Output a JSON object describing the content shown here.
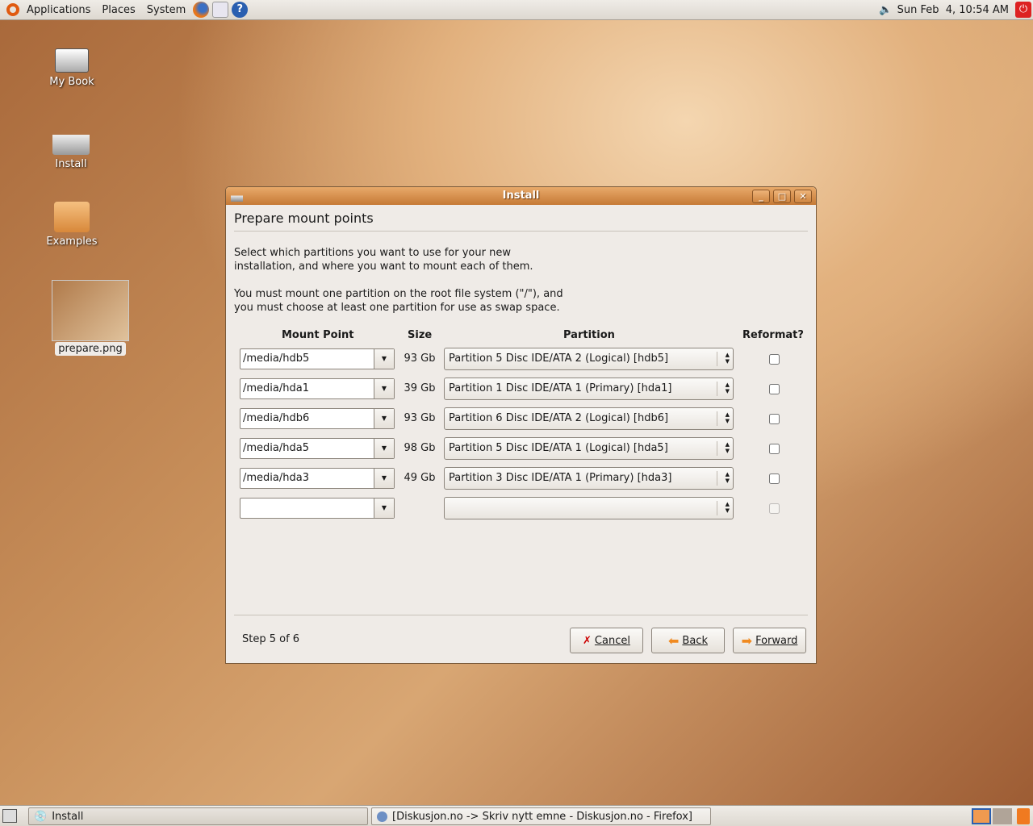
{
  "top_panel": {
    "menus": [
      "Applications",
      "Places",
      "System"
    ],
    "clock": "Sun Feb  4, 10:54 AM"
  },
  "desktop": {
    "icons": [
      "My Book",
      "Install",
      "Examples",
      "prepare.png"
    ]
  },
  "dialog": {
    "title": "Install",
    "heading": "Prepare mount points",
    "intro1": "Select which partitions you want to use for your new",
    "intro2": "installation, and where you want to mount each of them.",
    "intro3": "You must mount one partition on the root file system (\"/\"), and",
    "intro4": "you must choose at least one partition for use as swap space.",
    "columns": [
      "Mount Point",
      "Size",
      "Partition",
      "Reformat?"
    ],
    "rows": [
      {
        "mount": "/media/hdb5",
        "size": "93 Gb",
        "partition": "Partition 5 Disc IDE/ATA 2 (Logical) [hdb5]",
        "reformat": false
      },
      {
        "mount": "/media/hda1",
        "size": "39 Gb",
        "partition": "Partition 1 Disc IDE/ATA 1 (Primary) [hda1]",
        "reformat": false
      },
      {
        "mount": "/media/hdb6",
        "size": "93 Gb",
        "partition": "Partition 6 Disc IDE/ATA 2 (Logical) [hdb6]",
        "reformat": false
      },
      {
        "mount": "/media/hda5",
        "size": "98 Gb",
        "partition": "Partition 5 Disc IDE/ATA 1 (Logical) [hda5]",
        "reformat": false
      },
      {
        "mount": "/media/hda3",
        "size": "49 Gb",
        "partition": "Partition 3 Disc IDE/ATA 1 (Primary) [hda3]",
        "reformat": false
      },
      {
        "mount": "",
        "size": "",
        "partition": "",
        "reformat": false
      }
    ],
    "step": "Step 5 of 6",
    "cancel": "Cancel",
    "back": "Back",
    "forward": "Forward"
  },
  "taskbar": {
    "items": [
      "Install",
      "[Diskusjon.no -> Skriv nytt emne - Diskusjon.no - Firefox]"
    ]
  }
}
